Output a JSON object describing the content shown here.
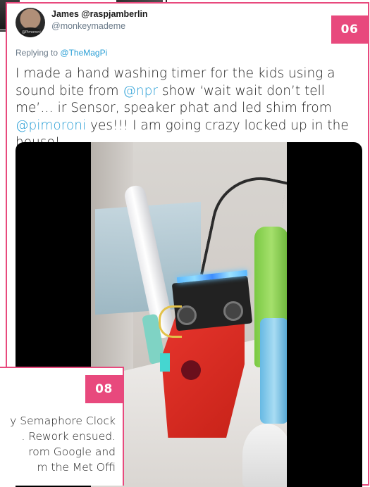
{
  "tweet": {
    "author_name": "James @raspjamberlin",
    "author_handle": "@monkeymademe",
    "badge": "06",
    "replying_prefix": "Replying to",
    "replying_to": "@TheMagPi",
    "text": {
      "p1": "I made a hand washing timer for the kids using a sound bite from ",
      "m1": "@npr",
      "p2": " show ‘wait wait don’t tell me’… ir Sensor, speaker phat and led shim from ",
      "m2": "@pimoroni",
      "p3": " yes!!! I am going crazy locked up in the house!"
    },
    "avatar_label": "@Pimoroni"
  },
  "second_card": {
    "badge": "08",
    "lines": [
      "y Semaphore Clock",
      ". Rework ensued.",
      "rom Google and",
      "m the Met Offi"
    ]
  },
  "colors": {
    "accent": "#e8497d",
    "link": "#2a9fd6",
    "muted": "#6b7b8a"
  }
}
